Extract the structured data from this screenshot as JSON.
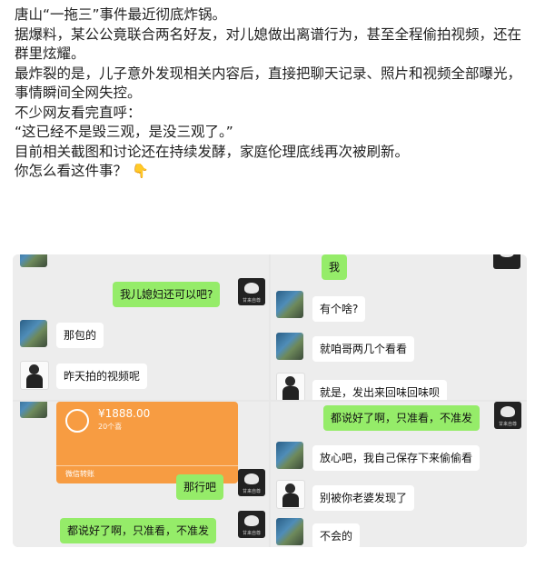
{
  "post": {
    "lines": [
      "唐山“一拖三”事件最近彻底炸锅。",
      "据爆料，某公公竟联合两名好友，对儿媳做出离谱行为，甚至全程偷拍视频，还在群里炫耀。",
      "最炸裂的是，儿子意外发现相关内容后，直接把聊天记录、照片和视频全部曝光，事情瞬间全网失控。",
      "不少网友看完直呼：",
      "“这已经不是毁三观，是没三观了。”",
      "目前相关截图和讨论还在持续发酵，家庭伦理底线再次被刷新。",
      "你怎么看这件事？"
    ],
    "emoji_icon": "pointing-down-hand"
  },
  "chat": {
    "panel1": {
      "m1": "我儿媳妇还可以吧?",
      "m2": "那包的",
      "m3": "昨天拍的视频呢"
    },
    "panel2": {
      "m1": "我",
      "m2": "有个啥?",
      "m3": "就咱哥两几个看看",
      "m4": "就是，发出来回味回味呗"
    },
    "panel3": {
      "transfer_amount": "¥1888.00",
      "transfer_sub": "20个喜",
      "transfer_foot": "微信转账",
      "m1": "那行吧",
      "m2": "都说好了啊，只准看，不准发"
    },
    "panel4": {
      "m1": "都说好了啊，只准看，不准发",
      "m2": "放心吧，我自己保存下来偷偷看",
      "m3": "别被你老婆发现了",
      "m4": "不会的"
    },
    "avatar_caption": "甘来自尊"
  }
}
